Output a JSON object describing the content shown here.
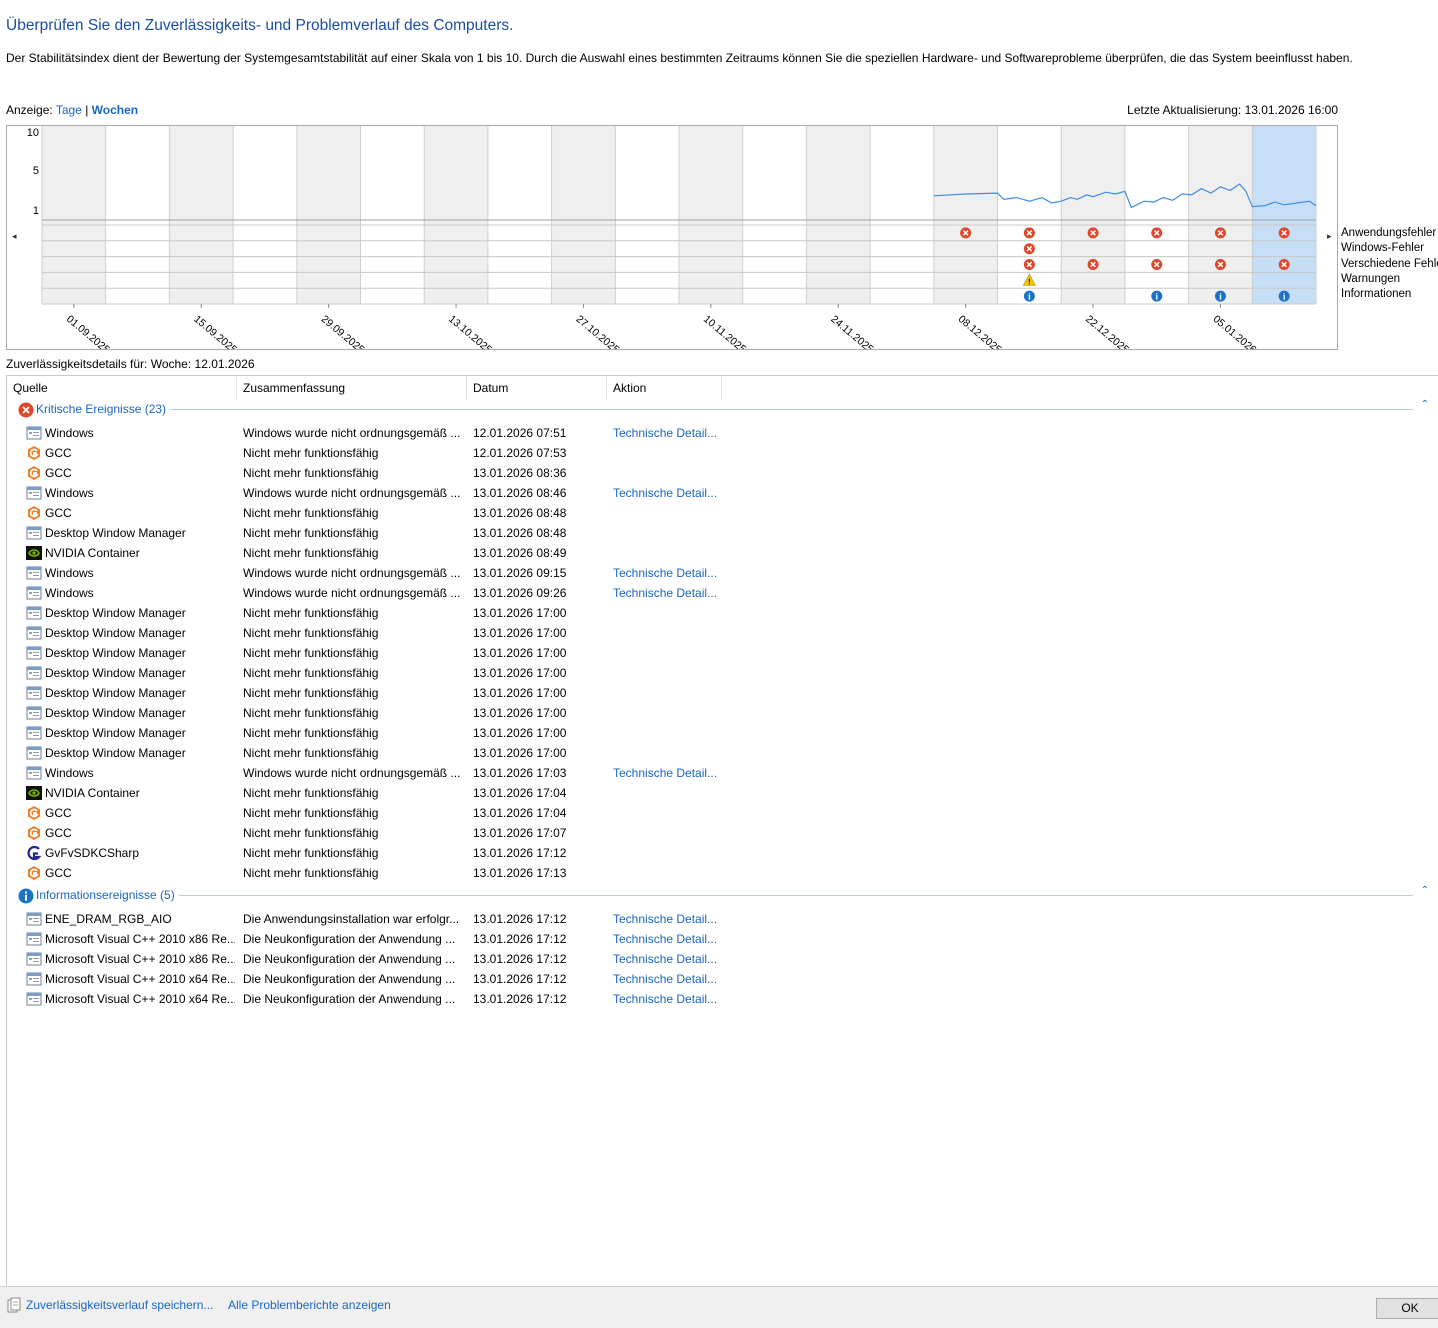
{
  "header": {
    "title": "Überprüfen Sie den Zuverlässigkeits- und Problemverlauf des Computers.",
    "description": "Der Stabilitätsindex dient der Bewertung der Systemgesamtstabilität auf einer Skala von 1 bis 10. Durch die Auswahl eines bestimmten Zeitraums können Sie die speziellen Hardware- und Softwareprobleme überprüfen, die das System beeinflusst haben."
  },
  "view": {
    "label": "Anzeige:",
    "days": "Tage",
    "separator": "|",
    "weeks": "Wochen",
    "last_update": "Letzte Aktualisierung: 13.01.2026 16:00"
  },
  "chart_data": {
    "type": "line",
    "y_ticks": [
      "10",
      "5",
      "1"
    ],
    "x_tick_labels": [
      "01.09.2025",
      "15.09.2025",
      "29.09.2025",
      "13.10.2025",
      "27.10.2025",
      "10.11.2025",
      "24.11.2025",
      "08.12.2025",
      "22.12.2025",
      "05.01.2026"
    ],
    "columns": 20,
    "selected_column": 19,
    "series": [
      {
        "values": [
          [
            14,
            2.8
          ],
          [
            14.5,
            3.0
          ],
          [
            15,
            3.1
          ],
          [
            15.1,
            2.4
          ],
          [
            15.3,
            2.6
          ],
          [
            15.5,
            2.2
          ],
          [
            15.7,
            2.6
          ],
          [
            15.85,
            2.0
          ],
          [
            16,
            2.2
          ],
          [
            16.15,
            2.6
          ],
          [
            16.25,
            2.4
          ],
          [
            16.4,
            2.9
          ],
          [
            16.5,
            2.7
          ],
          [
            16.7,
            3.2
          ],
          [
            16.85,
            3.0
          ],
          [
            17,
            3.3
          ],
          [
            17.1,
            1.5
          ],
          [
            17.3,
            2.2
          ],
          [
            17.45,
            2.1
          ],
          [
            17.6,
            2.6
          ],
          [
            17.75,
            2.3
          ],
          [
            17.9,
            3.0
          ],
          [
            18.05,
            2.9
          ],
          [
            18.2,
            3.6
          ],
          [
            18.35,
            3.1
          ],
          [
            18.5,
            3.8
          ],
          [
            18.65,
            3.4
          ],
          [
            18.8,
            4.1
          ],
          [
            18.9,
            3.3
          ],
          [
            19.0,
            1.6
          ],
          [
            19.2,
            1.7
          ],
          [
            19.35,
            2.1
          ],
          [
            19.5,
            1.8
          ],
          [
            19.7,
            2.0
          ],
          [
            19.9,
            2.2
          ],
          [
            20.0,
            1.7
          ]
        ]
      }
    ],
    "event_rows": [
      "Anwendungsfehler",
      "Windows-Fehler",
      "Verschiedene Fehler",
      "Warnungen",
      "Informationen"
    ],
    "events": [
      {
        "row": 0,
        "col": 14,
        "kind": "error"
      },
      {
        "row": 0,
        "col": 15,
        "kind": "error"
      },
      {
        "row": 0,
        "col": 16,
        "kind": "error"
      },
      {
        "row": 0,
        "col": 17,
        "kind": "error"
      },
      {
        "row": 0,
        "col": 18,
        "kind": "error"
      },
      {
        "row": 0,
        "col": 19,
        "kind": "error"
      },
      {
        "row": 1,
        "col": 15,
        "kind": "error"
      },
      {
        "row": 2,
        "col": 15,
        "kind": "error"
      },
      {
        "row": 2,
        "col": 16,
        "kind": "error"
      },
      {
        "row": 2,
        "col": 17,
        "kind": "error"
      },
      {
        "row": 2,
        "col": 18,
        "kind": "error"
      },
      {
        "row": 2,
        "col": 19,
        "kind": "error"
      },
      {
        "row": 3,
        "col": 15,
        "kind": "warning"
      },
      {
        "row": 4,
        "col": 15,
        "kind": "info"
      },
      {
        "row": 4,
        "col": 17,
        "kind": "info"
      },
      {
        "row": 4,
        "col": 18,
        "kind": "info"
      },
      {
        "row": 4,
        "col": 19,
        "kind": "info"
      }
    ],
    "colors": {
      "line": "#3a8ee6",
      "error": "#e0462a",
      "warning": "#f5c800",
      "info": "#1a73c8",
      "shaded": "#efefef",
      "selected": "#c6dff6"
    }
  },
  "details": {
    "label": "Zuverlässigkeitsdetails für: Woche: 12.01.2026"
  },
  "list": {
    "columns": [
      "Quelle",
      "Zusammenfassung",
      "Datum",
      "Aktion"
    ],
    "sort_glyph": "^",
    "groups": [
      {
        "title": "Kritische Ereignisse (23)",
        "icon": "error-icon",
        "collapse": "⌃",
        "rows": [
          {
            "icon": "app",
            "source": "Windows",
            "summary": "Windows wurde nicht ordnungsgemäß ...",
            "date": "12.01.2026 07:51",
            "action": "Technische Detail..."
          },
          {
            "icon": "gcc",
            "source": "GCC",
            "summary": "Nicht mehr funktionsfähig",
            "date": "12.01.2026 07:53",
            "action": ""
          },
          {
            "icon": "gcc",
            "source": "GCC",
            "summary": "Nicht mehr funktionsfähig",
            "date": "13.01.2026 08:36",
            "action": ""
          },
          {
            "icon": "app",
            "source": "Windows",
            "summary": "Windows wurde nicht ordnungsgemäß ...",
            "date": "13.01.2026 08:46",
            "action": "Technische Detail..."
          },
          {
            "icon": "gcc",
            "source": "GCC",
            "summary": "Nicht mehr funktionsfähig",
            "date": "13.01.2026 08:48",
            "action": ""
          },
          {
            "icon": "app",
            "source": "Desktop Window Manager",
            "summary": "Nicht mehr funktionsfähig",
            "date": "13.01.2026 08:48",
            "action": ""
          },
          {
            "icon": "nvidia",
            "source": "NVIDIA Container",
            "summary": "Nicht mehr funktionsfähig",
            "date": "13.01.2026 08:49",
            "action": ""
          },
          {
            "icon": "app",
            "source": "Windows",
            "summary": "Windows wurde nicht ordnungsgemäß ...",
            "date": "13.01.2026 09:15",
            "action": "Technische Detail..."
          },
          {
            "icon": "app",
            "source": "Windows",
            "summary": "Windows wurde nicht ordnungsgemäß ...",
            "date": "13.01.2026 09:26",
            "action": "Technische Detail..."
          },
          {
            "icon": "app",
            "source": "Desktop Window Manager",
            "summary": "Nicht mehr funktionsfähig",
            "date": "13.01.2026 17:00",
            "action": ""
          },
          {
            "icon": "app",
            "source": "Desktop Window Manager",
            "summary": "Nicht mehr funktionsfähig",
            "date": "13.01.2026 17:00",
            "action": ""
          },
          {
            "icon": "app",
            "source": "Desktop Window Manager",
            "summary": "Nicht mehr funktionsfähig",
            "date": "13.01.2026 17:00",
            "action": ""
          },
          {
            "icon": "app",
            "source": "Desktop Window Manager",
            "summary": "Nicht mehr funktionsfähig",
            "date": "13.01.2026 17:00",
            "action": ""
          },
          {
            "icon": "app",
            "source": "Desktop Window Manager",
            "summary": "Nicht mehr funktionsfähig",
            "date": "13.01.2026 17:00",
            "action": ""
          },
          {
            "icon": "app",
            "source": "Desktop Window Manager",
            "summary": "Nicht mehr funktionsfähig",
            "date": "13.01.2026 17:00",
            "action": ""
          },
          {
            "icon": "app",
            "source": "Desktop Window Manager",
            "summary": "Nicht mehr funktionsfähig",
            "date": "13.01.2026 17:00",
            "action": ""
          },
          {
            "icon": "app",
            "source": "Desktop Window Manager",
            "summary": "Nicht mehr funktionsfähig",
            "date": "13.01.2026 17:00",
            "action": ""
          },
          {
            "icon": "app",
            "source": "Windows",
            "summary": "Windows wurde nicht ordnungsgemäß ...",
            "date": "13.01.2026 17:03",
            "action": "Technische Detail..."
          },
          {
            "icon": "nvidia",
            "source": "NVIDIA Container",
            "summary": "Nicht mehr funktionsfähig",
            "date": "13.01.2026 17:04",
            "action": ""
          },
          {
            "icon": "gcc",
            "source": "GCC",
            "summary": "Nicht mehr funktionsfähig",
            "date": "13.01.2026 17:04",
            "action": ""
          },
          {
            "icon": "gcc",
            "source": "GCC",
            "summary": "Nicht mehr funktionsfähig",
            "date": "13.01.2026 17:07",
            "action": ""
          },
          {
            "icon": "gv",
            "source": "GvFvSDKCSharp",
            "summary": "Nicht mehr funktionsfähig",
            "date": "13.01.2026 17:12",
            "action": ""
          },
          {
            "icon": "gcc",
            "source": "GCC",
            "summary": "Nicht mehr funktionsfähig",
            "date": "13.01.2026 17:13",
            "action": ""
          }
        ]
      },
      {
        "title": "Informationsereignisse (5)",
        "icon": "info-icon",
        "collapse": "⌃",
        "rows": [
          {
            "icon": "app",
            "source": "ENE_DRAM_RGB_AIO",
            "summary": "Die Anwendungsinstallation war erfolgr...",
            "date": "13.01.2026 17:12",
            "action": "Technische Detail..."
          },
          {
            "icon": "app",
            "source": "Microsoft Visual C++ 2010  x86 Re...",
            "summary": "Die Neukonfiguration der Anwendung ...",
            "date": "13.01.2026 17:12",
            "action": "Technische Detail..."
          },
          {
            "icon": "app",
            "source": "Microsoft Visual C++ 2010  x86 Re...",
            "summary": "Die Neukonfiguration der Anwendung ...",
            "date": "13.01.2026 17:12",
            "action": "Technische Detail..."
          },
          {
            "icon": "app",
            "source": "Microsoft Visual C++ 2010  x64 Re...",
            "summary": "Die Neukonfiguration der Anwendung ...",
            "date": "13.01.2026 17:12",
            "action": "Technische Detail..."
          },
          {
            "icon": "app",
            "source": "Microsoft Visual C++ 2010  x64 Re...",
            "summary": "Die Neukonfiguration der Anwendung ...",
            "date": "13.01.2026 17:12",
            "action": "Technische Detail..."
          }
        ]
      }
    ]
  },
  "footer": {
    "save_link": "Zuverlässigkeitsverlauf speichern...",
    "all_reports_link": "Alle Problemberichte anzeigen",
    "ok_button": "OK"
  }
}
